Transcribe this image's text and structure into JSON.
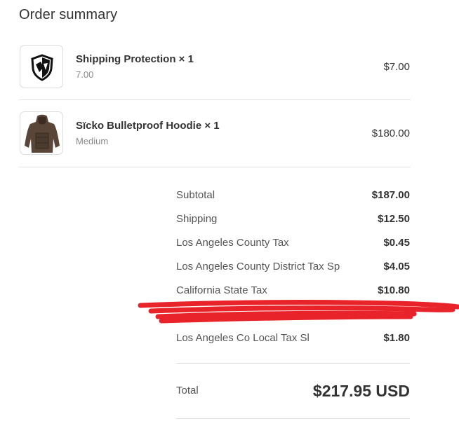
{
  "summary": {
    "title": "Order summary"
  },
  "items": [
    {
      "name": "Shipping Protection × 1",
      "variant": "7.00",
      "price": "$7.00",
      "icon": "shield-icon"
    },
    {
      "name": "Sïcko Bulletproof Hoodie × 1",
      "variant": "Medium",
      "price": "$180.00",
      "icon": "hoodie-image"
    }
  ],
  "breakdown": [
    {
      "label": "Subtotal",
      "value": "$187.00"
    },
    {
      "label": "Shipping",
      "value": "$12.50"
    },
    {
      "label": "Los Angeles County Tax",
      "value": "$0.45"
    },
    {
      "label": "Los Angeles County District Tax Sp",
      "value": "$4.05"
    },
    {
      "label": "California State Tax",
      "value": "$10.80"
    },
    {
      "label": "",
      "value": ""
    },
    {
      "label": "Los Angeles Co Local Tax Sl",
      "value": "$1.80"
    }
  ],
  "total": {
    "label": "Total",
    "value": "$217.95 USD"
  },
  "colors": {
    "redaction": "#e8232a",
    "divider": "#e3e3e3"
  }
}
